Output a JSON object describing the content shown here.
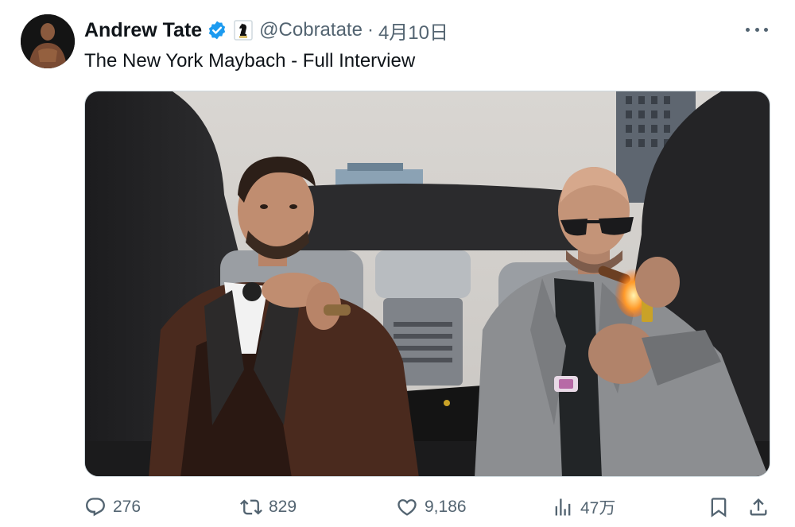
{
  "tweet": {
    "display_name": "Andrew Tate",
    "handle": "@Cobratate",
    "separator": "·",
    "time": "4月10日",
    "text": "The New York Maybach - Full Interview"
  },
  "actions": {
    "replies": "276",
    "reposts": "829",
    "likes": "9,186",
    "views": "47万"
  },
  "colors": {
    "verified": "#1d9bf0",
    "muted": "#536471",
    "text": "#0f1419"
  },
  "icons": {
    "verified": "verified-badge-icon",
    "affiliate": "chess-knight-icon",
    "more": "more-icon",
    "reply": "reply-icon",
    "repost": "repost-icon",
    "like": "like-icon",
    "views": "views-icon",
    "bookmark": "bookmark-icon",
    "share": "share-icon"
  }
}
